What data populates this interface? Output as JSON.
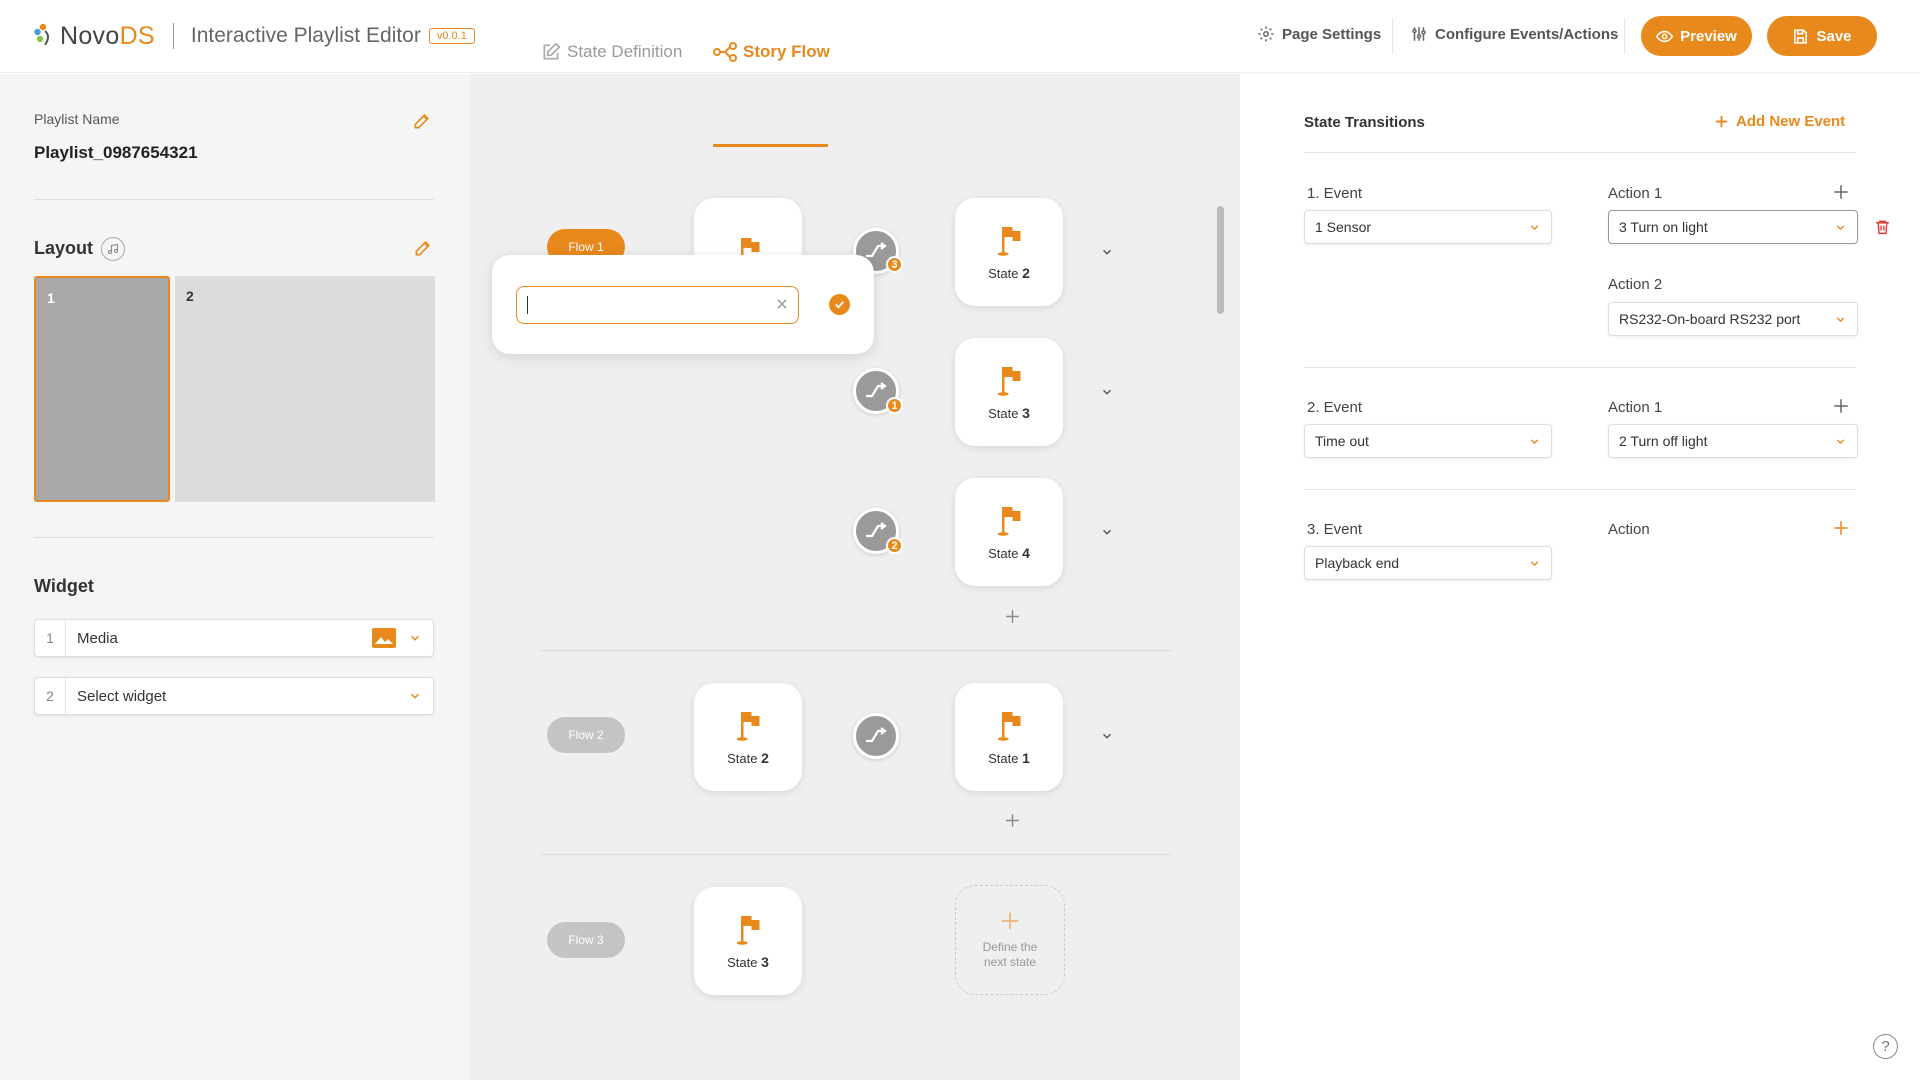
{
  "header": {
    "brand_prefix": "Novo",
    "brand_suffix": "DS",
    "app_title": "Interactive Playlist Editor",
    "version": "v0.0.1",
    "page_settings": "Page Settings",
    "configure": "Configure Events/Actions",
    "preview": "Preview",
    "save": "Save"
  },
  "left": {
    "playlist_label": "Playlist Name",
    "playlist_name": "Playlist_0987654321",
    "layout_title": "Layout",
    "layout_cells": [
      "1",
      "2"
    ],
    "widget_title": "Widget",
    "widgets": [
      {
        "num": "1",
        "name": "Media"
      },
      {
        "num": "2",
        "name": "Select widget"
      }
    ]
  },
  "middle": {
    "tabs": [
      "State Definition",
      "Story Flow"
    ],
    "active_tab": "Story Flow",
    "flows": [
      "Flow 1",
      "Flow 2",
      "Flow 3"
    ],
    "state_word": "State",
    "states": {
      "f1_src": "",
      "f1_t1": "2",
      "f1_t2": "3",
      "f1_t3": "4",
      "f2_src": "2",
      "f2_t1": "1",
      "f3_src": "3"
    },
    "transition_badges": [
      "3",
      "1",
      "2"
    ],
    "define_next": "Define the next state",
    "popover_input_value": ""
  },
  "right": {
    "title": "State Transitions",
    "add_event": "Add New Event",
    "events": [
      {
        "label": "1. Event",
        "value": "1 Sensor",
        "actions": [
          {
            "label": "Action 1",
            "value": "3  Turn on light"
          },
          {
            "label": "Action 2",
            "value": "RS232-On-board RS232 port"
          }
        ]
      },
      {
        "label": "2. Event",
        "value": "Time out",
        "actions": [
          {
            "label": "Action 1",
            "value": "2  Turn off light"
          }
        ]
      },
      {
        "label": "3. Event",
        "value": "Playback end",
        "actions": [
          {
            "label": "Action",
            "value": ""
          }
        ]
      }
    ],
    "help": "?"
  },
  "colors": {
    "accent": "#e8891c",
    "delete": "#e03a3a",
    "layout_selected": "#a8a8a8",
    "layout_other": "#dcdcdc"
  }
}
